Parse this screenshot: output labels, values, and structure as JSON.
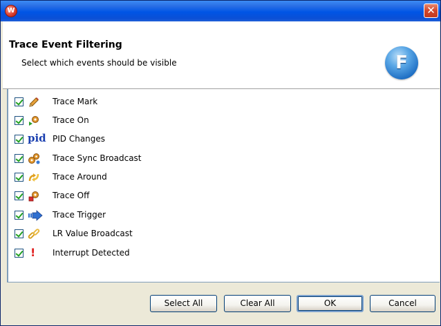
{
  "window": {
    "title": ""
  },
  "header": {
    "title": "Trace Event Filtering",
    "subtitle": "Select which events should be visible",
    "logo_letter": "F"
  },
  "events": [
    {
      "label": "Trace Mark",
      "checked": true,
      "icon": "pencil-icon"
    },
    {
      "label": "Trace On",
      "checked": true,
      "icon": "trace-on-gear-icon"
    },
    {
      "label": "PID Changes",
      "checked": true,
      "icon": "pid-icon",
      "icon_text": "pid"
    },
    {
      "label": "Trace Sync Broadcast",
      "checked": true,
      "icon": "sync-broadcast-gears-icon"
    },
    {
      "label": "Trace Around",
      "checked": true,
      "icon": "trace-around-arrows-icon"
    },
    {
      "label": "Trace Off",
      "checked": true,
      "icon": "trace-off-gear-icon"
    },
    {
      "label": "Trace Trigger",
      "checked": true,
      "icon": "trigger-arrow-icon"
    },
    {
      "label": "LR Value Broadcast",
      "checked": true,
      "icon": "chain-link-icon"
    },
    {
      "label": "Interrupt Detected",
      "checked": true,
      "icon": "exclamation-icon",
      "icon_text": "!"
    }
  ],
  "buttons": {
    "select_all": "Select All",
    "clear_all": "Clear All",
    "ok": "OK",
    "cancel": "Cancel"
  },
  "colors": {
    "titlebar": "#0055e5",
    "close_button": "#d2452a",
    "logo_blue": "#1f6fc4",
    "check_green": "#21a121",
    "pid_blue": "#1a3fb0",
    "exclamation_red": "#e02020",
    "trigger_blue": "#2f6fd0"
  }
}
